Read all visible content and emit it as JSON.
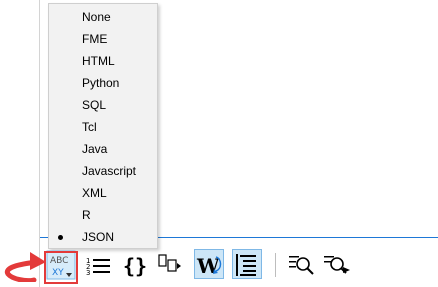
{
  "language_menu": {
    "items": [
      {
        "label": "None",
        "selected": false
      },
      {
        "label": "FME",
        "selected": false
      },
      {
        "label": "HTML",
        "selected": false
      },
      {
        "label": "Python",
        "selected": false
      },
      {
        "label": "SQL",
        "selected": false
      },
      {
        "label": "Tcl",
        "selected": false
      },
      {
        "label": "Java",
        "selected": false
      },
      {
        "label": "Javascript",
        "selected": false
      },
      {
        "label": "XML",
        "selected": false
      },
      {
        "label": "R",
        "selected": false
      },
      {
        "label": "JSON",
        "selected": true
      }
    ]
  },
  "toolbar": {
    "syntax_button_icon": "abc-xyz-dropdown-icon",
    "line_numbers_icon": "line-numbers-icon",
    "brace_matching_icon": "curly-braces-icon",
    "copy_icon": "stacked-boxes-icon",
    "word_wrap_icon": "word-wrap-icon",
    "indent_guides_icon": "indent-guides-icon",
    "find_icon": "find-icon",
    "find_replace_icon": "find-next-icon",
    "syntax_button_glyph_top": "ABC",
    "syntax_button_glyph_bottom": "XY",
    "brace_glyph": "{}"
  },
  "colors": {
    "highlight": "#e33a3a",
    "accent": "#1e78d7",
    "active_toggle": "#cde6f7"
  }
}
